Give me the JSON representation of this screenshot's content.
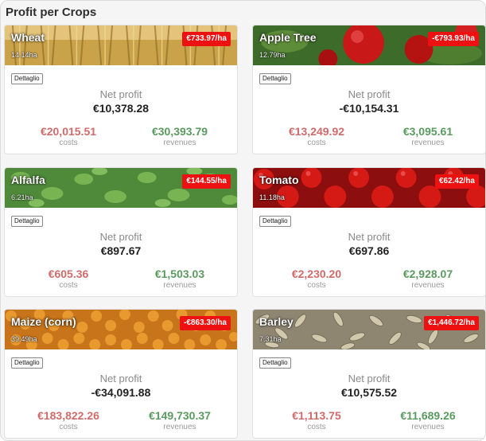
{
  "panel": {
    "title": "Profit per Crops"
  },
  "labels": {
    "detail": "Dettaglio",
    "net": "Net profit",
    "costs": "costs",
    "revenues": "revenues"
  },
  "colors": {
    "badge": "#ee1111",
    "costs": "#d06b6b",
    "revenues": "#5a9a5f"
  },
  "crops": [
    {
      "name": "Wheat",
      "area": "14.14ha",
      "rate": "€733.97/ha",
      "net": "€10,378.28",
      "costs": "€20,015.51",
      "revenues": "€30,393.79",
      "image": "wheat-field"
    },
    {
      "name": "Apple Tree",
      "area": "12.79ha",
      "rate": "-€793.93/ha",
      "net": "-€10,154.31",
      "costs": "€13,249.92",
      "revenues": "€3,095.61",
      "image": "red-apples"
    },
    {
      "name": "Alfalfa",
      "area": "6.21ha",
      "rate": "€144.55/ha",
      "net": "€897.67",
      "costs": "€605.36",
      "revenues": "€1,503.03",
      "image": "alfalfa-leaves"
    },
    {
      "name": "Tomato",
      "area": "11.18ha",
      "rate": "€62.42/ha",
      "net": "€697.86",
      "costs": "€2,230.20",
      "revenues": "€2,928.07",
      "image": "red-tomatoes"
    },
    {
      "name": "Maize (corn)",
      "area": "39.49ha",
      "rate": "-€863.30/ha",
      "net": "-€34,091.88",
      "costs": "€183,822.26",
      "revenues": "€149,730.37",
      "image": "corn-kernels"
    },
    {
      "name": "Barley",
      "area": "7.31ha",
      "rate": "€1,446.72/ha",
      "net": "€10,575.52",
      "costs": "€1,113.75",
      "revenues": "€11,689.26",
      "image": "barley-grains"
    }
  ]
}
